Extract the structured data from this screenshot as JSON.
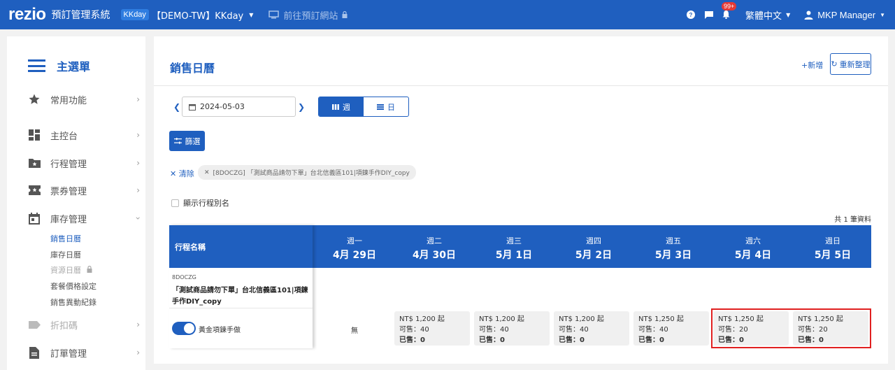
{
  "topbar": {
    "logo": "rezio",
    "app_title": "預訂管理系統",
    "brand_badge": "KKday",
    "company": "【DEMO-TW】KKday",
    "goto_site": "前往預訂網站",
    "notification_count": "99+",
    "language": "繁體中文",
    "user": "MKP Manager"
  },
  "sidebar": {
    "title": "主選單",
    "items": [
      {
        "label": "常用功能",
        "icon": "star-icon"
      },
      {
        "label": "主控台",
        "icon": "dashboard-icon"
      },
      {
        "label": "行程管理",
        "icon": "folder-star-icon"
      },
      {
        "label": "票券管理",
        "icon": "ticket-icon"
      },
      {
        "label": "庫存管理",
        "icon": "calendar-icon"
      },
      {
        "label": "折扣碼",
        "icon": "tag-icon"
      },
      {
        "label": "訂單管理",
        "icon": "document-icon"
      }
    ],
    "sub_items": [
      "銷售日曆",
      "庫存日曆",
      "資源日曆",
      "套餐價格設定",
      "銷售異動紀錄"
    ]
  },
  "main": {
    "title": "銷售日曆",
    "add_label": "新增",
    "reorganize_label": "重新整理",
    "date": "2024-05-03",
    "view_week": "週",
    "view_day": "日",
    "filter_label": "篩選",
    "clear_label": "清除",
    "filter_chip": "[8DOCZG] 「測試商品請勿下單」台北信義區101|項鍊手作DIY_copy",
    "show_alias_label": "顯示行程別名",
    "record_count": "共 1 筆資料"
  },
  "calendar": {
    "name_header": "行程名稱",
    "days": [
      {
        "weekday": "週一",
        "date": "4月 29日"
      },
      {
        "weekday": "週二",
        "date": "4月 30日"
      },
      {
        "weekday": "週三",
        "date": "5月 1日"
      },
      {
        "weekday": "週四",
        "date": "5月 2日"
      },
      {
        "weekday": "週五",
        "date": "5月 3日"
      },
      {
        "weekday": "週六",
        "date": "5月 4日"
      },
      {
        "weekday": "週日",
        "date": "5月 5日"
      }
    ],
    "product": {
      "code": "8DOCZG",
      "name": "「測試商品請勿下單」台北信義區101|項鍊手作DIY_copy",
      "package": "黃金項鍊手做",
      "package_enabled": true,
      "none_label": "無",
      "slots": [
        {
          "price": "NT$ 1,200 起",
          "available": "可售：40",
          "sold": "已售：0"
        },
        {
          "price": "NT$ 1,200 起",
          "available": "可售：40",
          "sold": "已售：0"
        },
        {
          "price": "NT$ 1,200 起",
          "available": "可售：40",
          "sold": "已售：0"
        },
        {
          "price": "NT$ 1,250 起",
          "available": "可售：40",
          "sold": "已售：0"
        },
        {
          "price": "NT$ 1,250 起",
          "available": "可售：20",
          "sold": "已售：0"
        },
        {
          "price": "NT$ 1,250 起",
          "available": "可售：20",
          "sold": "已售：0"
        }
      ]
    }
  },
  "colors": {
    "primary": "#1f5fbf",
    "highlight": "#e02020"
  }
}
